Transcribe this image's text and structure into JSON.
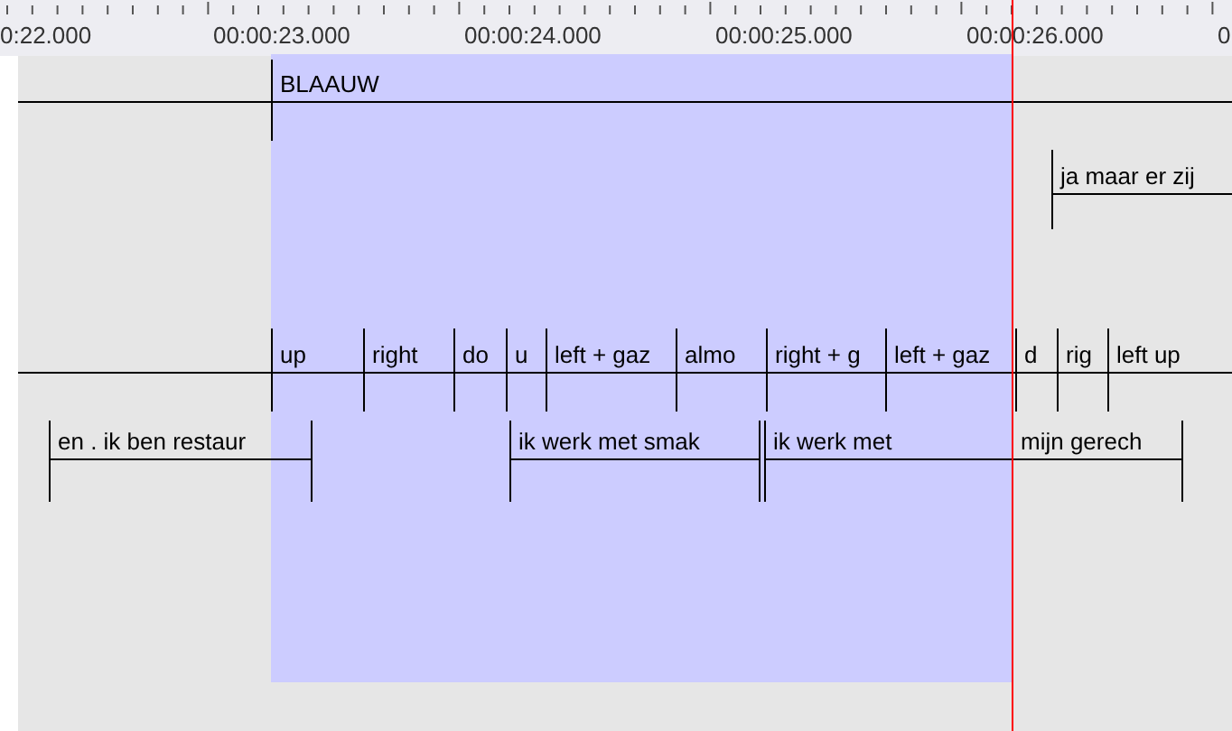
{
  "ruler": {
    "labels": [
      "0:22.000",
      "00:00:23.000",
      "00:00:24.000",
      "00:00:25.000",
      "00:00:26.000",
      "0"
    ]
  },
  "tiers": [
    {
      "annotations": [
        {
          "text": "BLAAUW"
        }
      ]
    },
    {
      "annotations": [
        {
          "text": "ja maar er zij"
        }
      ]
    },
    {
      "annotations": [
        {
          "text": "up"
        },
        {
          "text": "right"
        },
        {
          "text": "do"
        },
        {
          "text": "u"
        },
        {
          "text": "left + gaz"
        },
        {
          "text": "almo"
        },
        {
          "text": "right + g"
        },
        {
          "text": "left + gaz"
        },
        {
          "text": "d"
        },
        {
          "text": "rig"
        },
        {
          "text": "left up"
        }
      ]
    },
    {
      "annotations": [
        {
          "text": "en . ik ben restaur"
        },
        {
          "text": "ik werk met smak"
        },
        {
          "text": "ik werk met"
        },
        {
          "text": "mijn gerech"
        }
      ]
    }
  ]
}
